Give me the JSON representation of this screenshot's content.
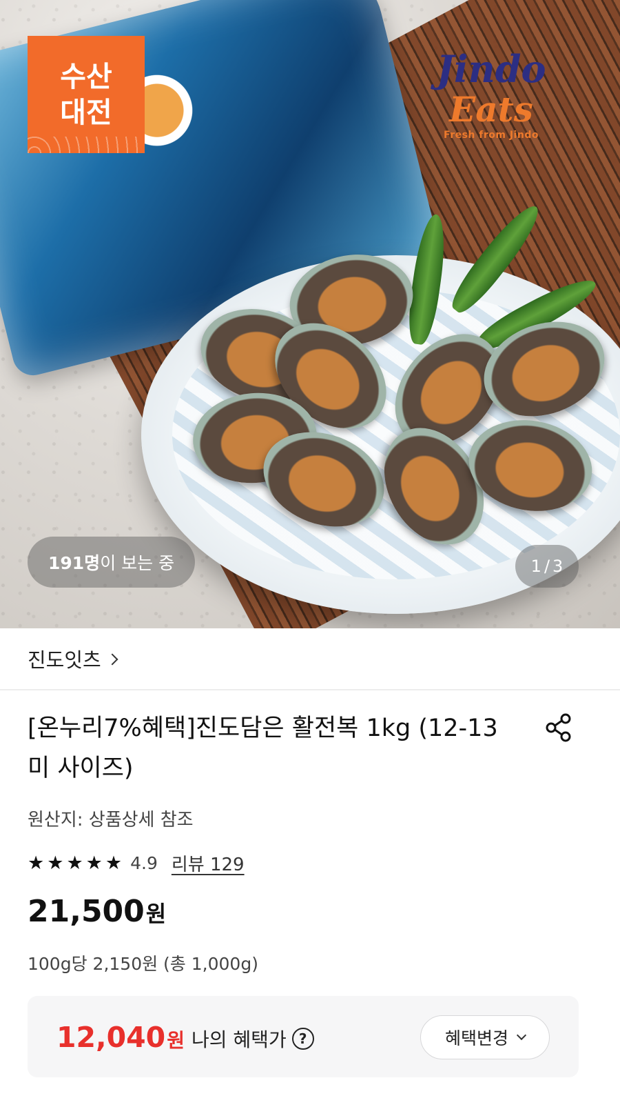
{
  "hero": {
    "badge_line1": "수산",
    "badge_line2": "대전",
    "brand_line1": "Jindo",
    "brand_line2": "Eats",
    "brand_tagline": "Fresh from Jindo",
    "viewers_count": "191명",
    "viewers_suffix": "이 보는 중",
    "pager_current": "1",
    "pager_sep": "/",
    "pager_total": "3"
  },
  "seller": {
    "name": "진도잇츠"
  },
  "product": {
    "title": "[온누리7%혜택]진도담은 활전복 1kg (12-13미 사이즈)",
    "origin": "원산지: 상품상세 참조",
    "rating": "4.9",
    "rating_stars": 5,
    "review_label": "리뷰 129",
    "price": "21,500",
    "price_unit": "원",
    "unit_price": "100g당 2,150원 (총 1,000g)"
  },
  "benefit": {
    "price": "12,040",
    "price_unit": "원",
    "label": "나의 혜택가",
    "help_glyph": "?",
    "change_label": "혜택변경"
  },
  "colors": {
    "accent_red": "#e8302c",
    "badge_orange": "#f26b2a",
    "brand_navy": "#2c2e83"
  }
}
